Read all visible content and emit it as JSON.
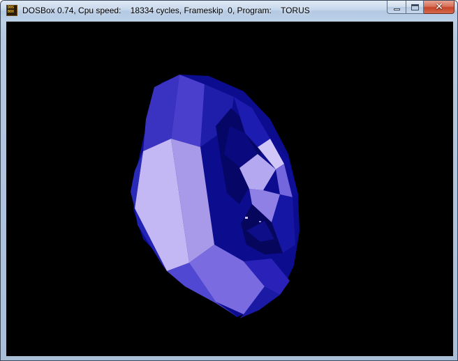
{
  "window": {
    "title": "DOSBox 0.74, Cpu speed:    18334 cycles, Frameskip  0, Program:    TORUS",
    "icon": {
      "name": "dosbox-icon",
      "line1": "DOS",
      "line2": "BOX"
    },
    "buttons": {
      "minimize": "minimize-icon",
      "maximize": "maximize-icon",
      "close": "close-icon"
    }
  },
  "scene": {
    "object": "torus",
    "background_color": "#000000",
    "shade_colors": [
      "#0a0a88",
      "#1a1aa8",
      "#2a2ac4",
      "#4238c8",
      "#5a4ed8",
      "#7a6ae0",
      "#9a8ce8",
      "#b8acf2",
      "#c8bcf6"
    ]
  }
}
